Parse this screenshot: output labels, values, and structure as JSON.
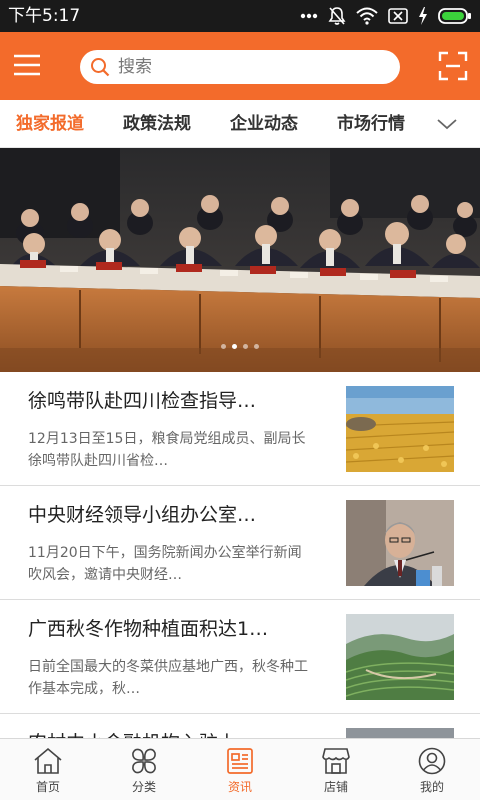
{
  "status_bar": {
    "time": "下午5:17",
    "icons": [
      "more-dots-icon",
      "mute-icon",
      "wifi-icon",
      "sim-off-icon",
      "charging-icon",
      "battery-icon"
    ]
  },
  "header": {
    "search_placeholder": "搜索",
    "icons": [
      "menu-icon",
      "search-icon",
      "scan-icon"
    ],
    "brand_color": "#f36b2b"
  },
  "tabs": [
    {
      "label": "独家报道",
      "active": true
    },
    {
      "label": "政策法规",
      "active": false
    },
    {
      "label": "企业动态",
      "active": false
    },
    {
      "label": "市场行情",
      "active": false
    }
  ],
  "banner": {
    "slide_count": 4,
    "active_slide": 2
  },
  "news": [
    {
      "title": "徐鸣带队赴四川检查指导…",
      "desc": "12月13日至15日，粮食局党组成员、副局长徐鸣带队赴四川省检…"
    },
    {
      "title": "中央财经领导小组办公室…",
      "desc": "11月20日下午，国务院新闻办公室举行新闻吹风会，邀请中央财经…"
    },
    {
      "title": "广西秋冬作物种植面积达1…",
      "desc": "日前全国最大的冬菜供应基地广西，秋冬种工作基本完成，秋…"
    },
    {
      "title": "农村中小金融机构入驻上…",
      "desc": ""
    }
  ],
  "bottom_nav": [
    {
      "label": "首页",
      "icon": "home-icon",
      "active": false
    },
    {
      "label": "分类",
      "icon": "category-icon",
      "active": false
    },
    {
      "label": "资讯",
      "icon": "news-icon",
      "active": true
    },
    {
      "label": "店铺",
      "icon": "store-icon",
      "active": false
    },
    {
      "label": "我的",
      "icon": "profile-icon",
      "active": false
    }
  ]
}
